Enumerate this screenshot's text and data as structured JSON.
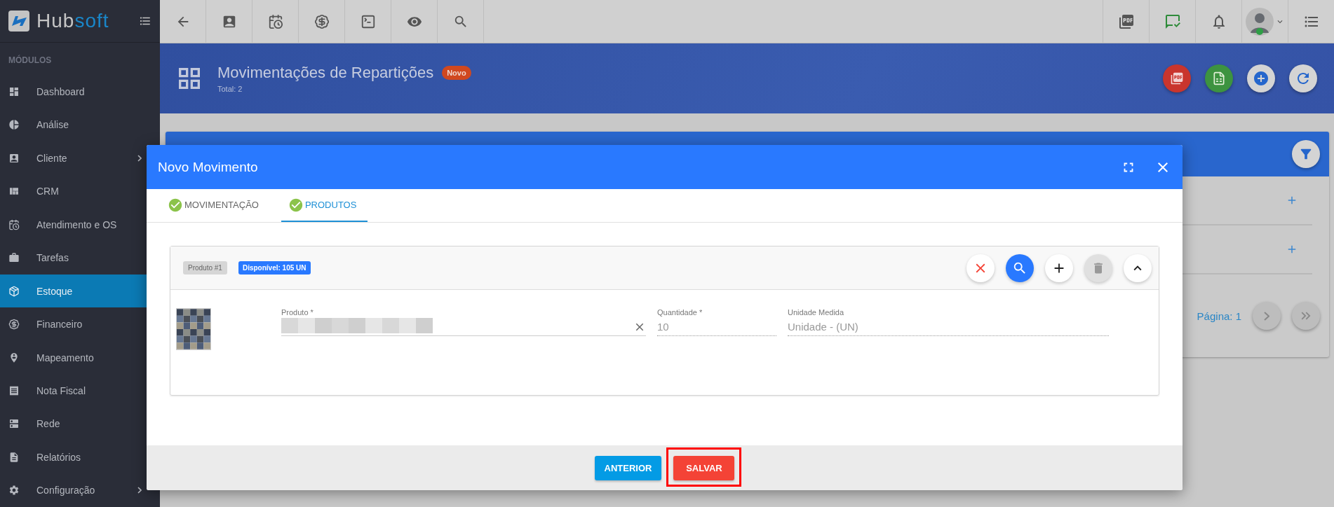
{
  "brand": {
    "first": "Hub",
    "second": "soft"
  },
  "sidebar": {
    "section": "MÓDULOS",
    "items": [
      {
        "label": "Dashboard",
        "selected": false,
        "expandable": false
      },
      {
        "label": "Análise",
        "selected": false,
        "expandable": false
      },
      {
        "label": "Cliente",
        "selected": false,
        "expandable": true
      },
      {
        "label": "CRM",
        "selected": false,
        "expandable": false
      },
      {
        "label": "Atendimento e OS",
        "selected": false,
        "expandable": false
      },
      {
        "label": "Tarefas",
        "selected": false,
        "expandable": false
      },
      {
        "label": "Estoque",
        "selected": true,
        "expandable": false
      },
      {
        "label": "Financeiro",
        "selected": false,
        "expandable": false
      },
      {
        "label": "Mapeamento",
        "selected": false,
        "expandable": false
      },
      {
        "label": "Nota Fiscal",
        "selected": false,
        "expandable": false
      },
      {
        "label": "Rede",
        "selected": false,
        "expandable": false
      },
      {
        "label": "Relatórios",
        "selected": false,
        "expandable": false
      },
      {
        "label": "Configuração",
        "selected": false,
        "expandable": true
      }
    ]
  },
  "header": {
    "title": "Movimentações de Repartições",
    "badge": "Novo",
    "subtitle": "Total: 2"
  },
  "background_panel": {
    "pagination": "Página: 1"
  },
  "modal": {
    "title": "Novo Movimento",
    "tabs": [
      {
        "label": "MOVIMENTAÇÃO",
        "selected": false,
        "completed": true
      },
      {
        "label": "PRODUTOS",
        "selected": true,
        "completed": true
      }
    ],
    "product": {
      "tag": "Produto #1",
      "availability": "Disponível: 105 UN",
      "fields": [
        {
          "kind": "redacted",
          "label": "Produto *",
          "disabled": false
        },
        {
          "kind": "text",
          "label": "Quantidade *",
          "value": "10",
          "disabled": true
        },
        {
          "kind": "text",
          "label": "Unidade Medida",
          "value": "Unidade - (UN)",
          "disabled": true
        }
      ]
    },
    "buttons": [
      {
        "label": "ANTERIOR",
        "kind": "secondary",
        "highlighted": false
      },
      {
        "label": "SALVAR",
        "kind": "primary",
        "highlighted": true
      }
    ]
  }
}
